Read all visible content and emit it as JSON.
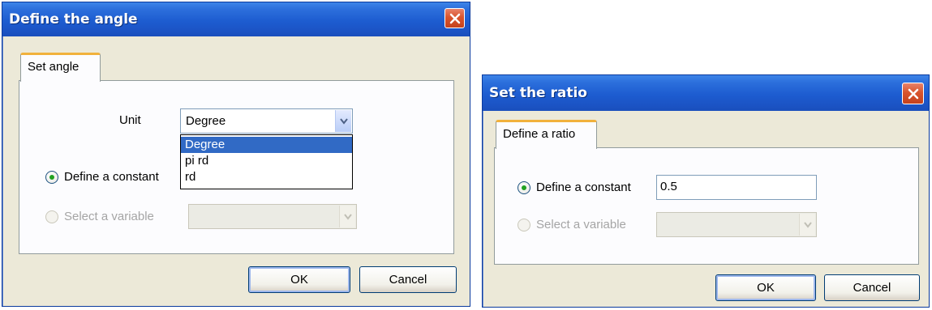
{
  "angle_dialog": {
    "title": "Define the angle",
    "tab_label": "Set angle",
    "unit_label": "Unit",
    "unit_selected": "Degree",
    "unit_options": [
      "Degree",
      "pi rd",
      "rd"
    ],
    "define_constant_label": "Define a constant",
    "select_variable_label": "Select a variable",
    "ok_label": "OK",
    "cancel_label": "Cancel"
  },
  "ratio_dialog": {
    "title": "Set the ratio",
    "tab_label": "Define a ratio",
    "define_constant_label": "Define a constant",
    "constant_value": "0.5",
    "select_variable_label": "Select a variable",
    "ok_label": "OK",
    "cancel_label": "Cancel"
  },
  "colors": {
    "titlebar": "#1d5cd0",
    "dialog_bg": "#ece9d8",
    "selection": "#316ac5",
    "tab_accent": "#f1b13c",
    "close_button": "#d9542d"
  },
  "icons": {
    "close": "close-icon",
    "combo_arrow": "chevron-down-icon"
  }
}
